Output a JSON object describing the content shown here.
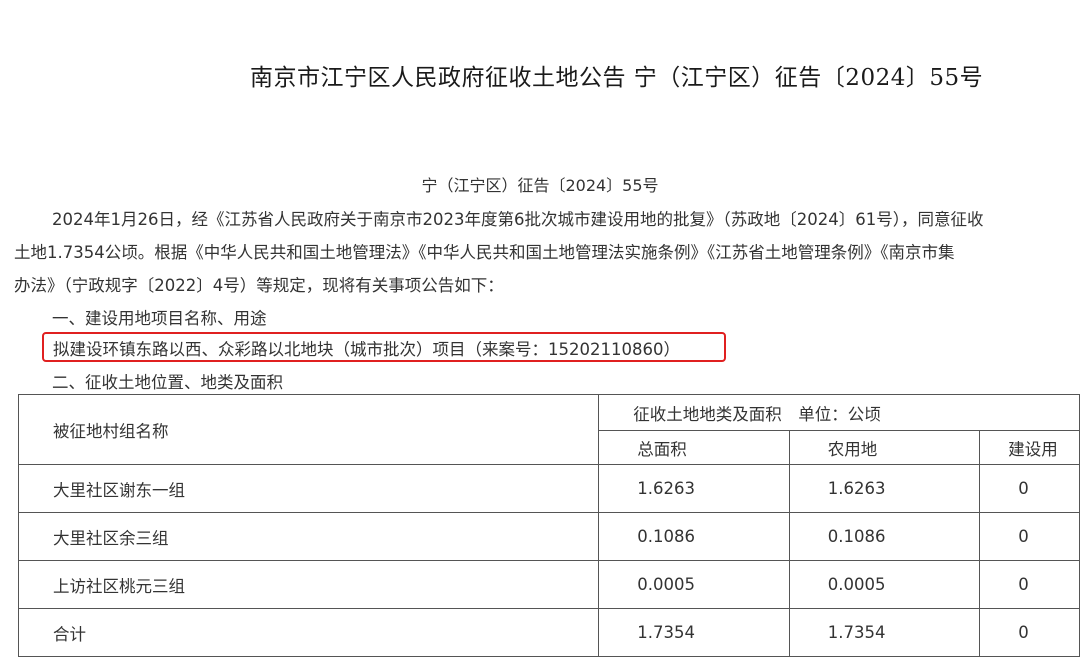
{
  "title": "南京市江宁区人民政府征收土地公告 宁（江宁区）征告〔2024〕55号",
  "doc_number": "宁（江宁区）征告〔2024〕55号",
  "paragraph_lines": [
    "2024年1月26日，经《江苏省人民政府关于南京市2023年度第6批次城市建设用地的批复》（苏政地〔2024〕61号），同意征收",
    "土地1.7354公顷。根据《中华人民共和国土地管理法》《中华人民共和国土地管理法实施条例》《江苏省土地管理条例》《南京市集",
    "办法》（宁政规字〔2022〕4号）等规定，现将有关事项公告如下："
  ],
  "section1_heading": "一、建设用地项目名称、用途",
  "project_line": "拟建设环镇东路以西、众彩路以北地块（城市批次）项目（来案号：15202110860）",
  "section2_heading": "二、征收土地位置、地类及面积",
  "table": {
    "village_header": "被征地村组名称",
    "group_header": "征收土地地类及面积　单位：公顷",
    "col_total": "总面积",
    "col_farmland": "农用地",
    "col_construction": "建设用",
    "rows": [
      {
        "name": "大里社区谢东一组",
        "total": "1.6263",
        "farmland": "1.6263",
        "construction": "0"
      },
      {
        "name": "大里社区余三组",
        "total": "0.1086",
        "farmland": "0.1086",
        "construction": "0"
      },
      {
        "name": "上访社区桃元三组",
        "total": "0.0005",
        "farmland": "0.0005",
        "construction": "0"
      },
      {
        "name": "合计",
        "total": "1.7354",
        "farmland": "1.7354",
        "construction": "0"
      }
    ]
  },
  "colors": {
    "highlight_border": "#e02020",
    "text": "#333333"
  }
}
